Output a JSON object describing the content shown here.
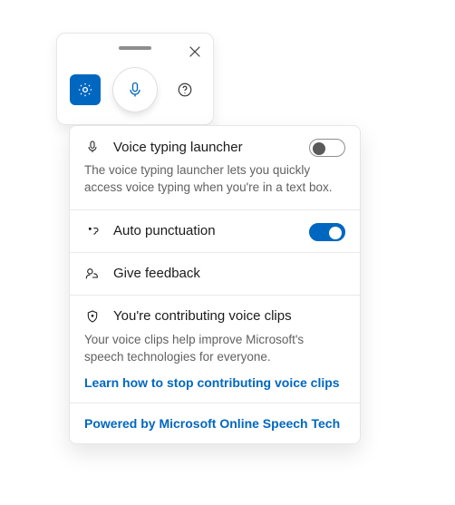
{
  "toolbar": {
    "settings_name": "settings",
    "mic_name": "microphone",
    "help_name": "help",
    "close_name": "close"
  },
  "panel": {
    "launcher": {
      "title": "Voice typing launcher",
      "desc": "The voice typing launcher lets you quickly access voice typing when you're in a text box.",
      "on": false
    },
    "autopunct": {
      "title": "Auto punctuation",
      "on": true
    },
    "feedback": {
      "title": "Give feedback"
    },
    "contribute": {
      "title": "You're contributing voice clips",
      "desc": "Your voice clips help improve Microsoft's speech technologies for everyone.",
      "link": "Learn how to stop contributing voice clips"
    },
    "powered": "Powered by Microsoft Online Speech Tech"
  }
}
